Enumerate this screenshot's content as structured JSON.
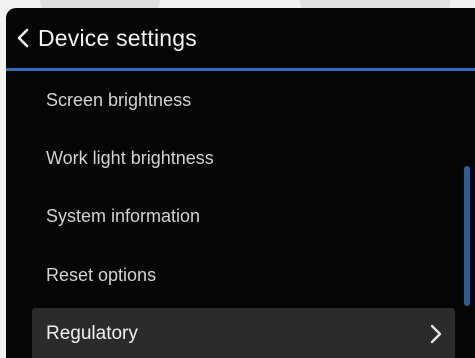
{
  "header": {
    "title": "Device settings",
    "back_icon": "chevron-left-icon"
  },
  "menu": {
    "items": [
      {
        "label": "Screen brightness"
      },
      {
        "label": "Work light brightness"
      },
      {
        "label": "System information"
      },
      {
        "label": "Reset options"
      },
      {
        "label": "Regulatory",
        "selected": true,
        "icon": "chevron-right-icon"
      }
    ]
  },
  "colors": {
    "background": "#050505",
    "accent": "#2f6fb3",
    "selected_row": "#2b2b2b",
    "text": "#d2d2d2"
  }
}
